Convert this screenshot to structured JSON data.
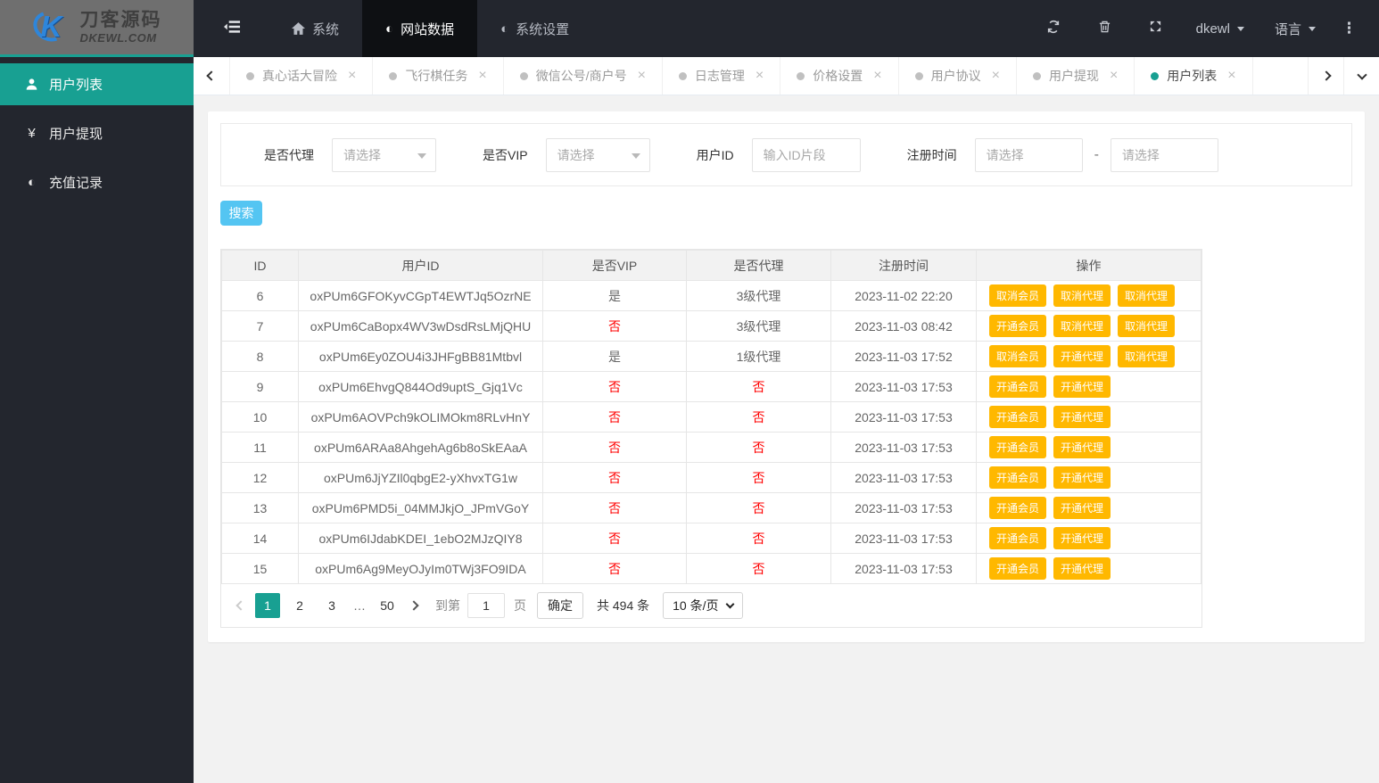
{
  "header": {
    "logo": {
      "title_cn": "刀客源码",
      "title_en": "DKEWL.COM"
    },
    "nav": [
      {
        "id": "system",
        "icon": "home",
        "label": "系统",
        "active": false
      },
      {
        "id": "site-data",
        "icon": "adjust",
        "label": "网站数据",
        "active": true
      },
      {
        "id": "system-settings",
        "icon": "adjust",
        "label": "系统设置",
        "active": false
      }
    ],
    "username": "dkewl",
    "language_label": "语言"
  },
  "sidebar": {
    "items": [
      {
        "id": "user-list",
        "icon": "user",
        "label": "用户列表",
        "active": true
      },
      {
        "id": "user-withdraw",
        "icon": "yen",
        "label": "用户提现",
        "active": false
      },
      {
        "id": "recharge-records",
        "icon": "adjust",
        "label": "充值记录",
        "active": false
      }
    ]
  },
  "tabs": {
    "items": [
      {
        "id": "truth-dare",
        "label": "真心话大冒险",
        "active": false
      },
      {
        "id": "flight-chess",
        "label": "飞行棋任务",
        "active": false
      },
      {
        "id": "wechat-account",
        "label": "微信公号/商户号",
        "active": false
      },
      {
        "id": "log-management",
        "label": "日志管理",
        "active": false
      },
      {
        "id": "price-settings",
        "label": "价格设置",
        "active": false
      },
      {
        "id": "user-agreement",
        "label": "用户协议",
        "active": false
      },
      {
        "id": "user-withdraw",
        "label": "用户提现",
        "active": false
      },
      {
        "id": "user-list",
        "label": "用户列表",
        "active": true
      }
    ]
  },
  "filters": {
    "agent_label": "是否代理",
    "agent_placeholder": "请选择",
    "vip_label": "是否VIP",
    "vip_placeholder": "请选择",
    "userid_label": "用户ID",
    "userid_placeholder": "输入ID片段",
    "regtime_label": "注册时间",
    "regtime_from_placeholder": "请选择",
    "regtime_to_placeholder": "请选择",
    "range_separator": "-",
    "search_label": "搜索"
  },
  "table": {
    "columns": [
      "ID",
      "用户ID",
      "是否VIP",
      "是否代理",
      "注册时间",
      "操作"
    ],
    "rows": [
      {
        "id": "6",
        "user_id": "oxPUm6GFOKyvCGpT4EWTJq5OzrNE",
        "vip": "是",
        "agent": "3级代理",
        "reg_time": "2023-11-02 22:20",
        "actions": [
          "取消会员",
          "取消代理",
          "取消代理"
        ]
      },
      {
        "id": "7",
        "user_id": "oxPUm6CaBopx4WV3wDsdRsLMjQHU",
        "vip": "否",
        "agent": "3级代理",
        "reg_time": "2023-11-03 08:42",
        "actions": [
          "开通会员",
          "取消代理",
          "取消代理"
        ]
      },
      {
        "id": "8",
        "user_id": "oxPUm6Ey0ZOU4i3JHFgBB81Mtbvl",
        "vip": "是",
        "agent": "1级代理",
        "reg_time": "2023-11-03 17:52",
        "actions": [
          "取消会员",
          "开通代理",
          "取消代理"
        ]
      },
      {
        "id": "9",
        "user_id": "oxPUm6EhvgQ844Od9uptS_Gjq1Vc",
        "vip": "否",
        "agent": "否",
        "reg_time": "2023-11-03 17:53",
        "actions": [
          "开通会员",
          "开通代理"
        ]
      },
      {
        "id": "10",
        "user_id": "oxPUm6AOVPch9kOLIMOkm8RLvHnY",
        "vip": "否",
        "agent": "否",
        "reg_time": "2023-11-03 17:53",
        "actions": [
          "开通会员",
          "开通代理"
        ]
      },
      {
        "id": "11",
        "user_id": "oxPUm6ARAa8AhgehAg6b8oSkEAaA",
        "vip": "否",
        "agent": "否",
        "reg_time": "2023-11-03 17:53",
        "actions": [
          "开通会员",
          "开通代理"
        ]
      },
      {
        "id": "12",
        "user_id": "oxPUm6JjYZIl0qbgE2-yXhvxTG1w",
        "vip": "否",
        "agent": "否",
        "reg_time": "2023-11-03 17:53",
        "actions": [
          "开通会员",
          "开通代理"
        ]
      },
      {
        "id": "13",
        "user_id": "oxPUm6PMD5i_04MMJkjO_JPmVGoY",
        "vip": "否",
        "agent": "否",
        "reg_time": "2023-11-03 17:53",
        "actions": [
          "开通会员",
          "开通代理"
        ]
      },
      {
        "id": "14",
        "user_id": "oxPUm6IJdabKDEI_1ebO2MJzQIY8",
        "vip": "否",
        "agent": "否",
        "reg_time": "2023-11-03 17:53",
        "actions": [
          "开通会员",
          "开通代理"
        ]
      },
      {
        "id": "15",
        "user_id": "oxPUm6Ag9MeyOJyIm0TWj3FO9IDA",
        "vip": "否",
        "agent": "否",
        "reg_time": "2023-11-03 17:53",
        "actions": [
          "开通会员",
          "开通代理"
        ]
      }
    ]
  },
  "pagination": {
    "pages": [
      "1",
      "2",
      "3",
      "…",
      "50"
    ],
    "active_page": "1",
    "goto_label": "到第",
    "goto_value": "1",
    "goto_unit": "页",
    "confirm_label": "确定",
    "total_text": "共 494 条",
    "page_size_text": "10 条/页"
  },
  "colors": {
    "accent_teal": "#18A092",
    "header_bg": "#23262E",
    "active_nav_bg": "#0E1013",
    "logo_bg": "#6F6F6F",
    "action_orange": "#FFB800",
    "danger_red": "#FF0000",
    "search_blue": "#54C5F2"
  }
}
